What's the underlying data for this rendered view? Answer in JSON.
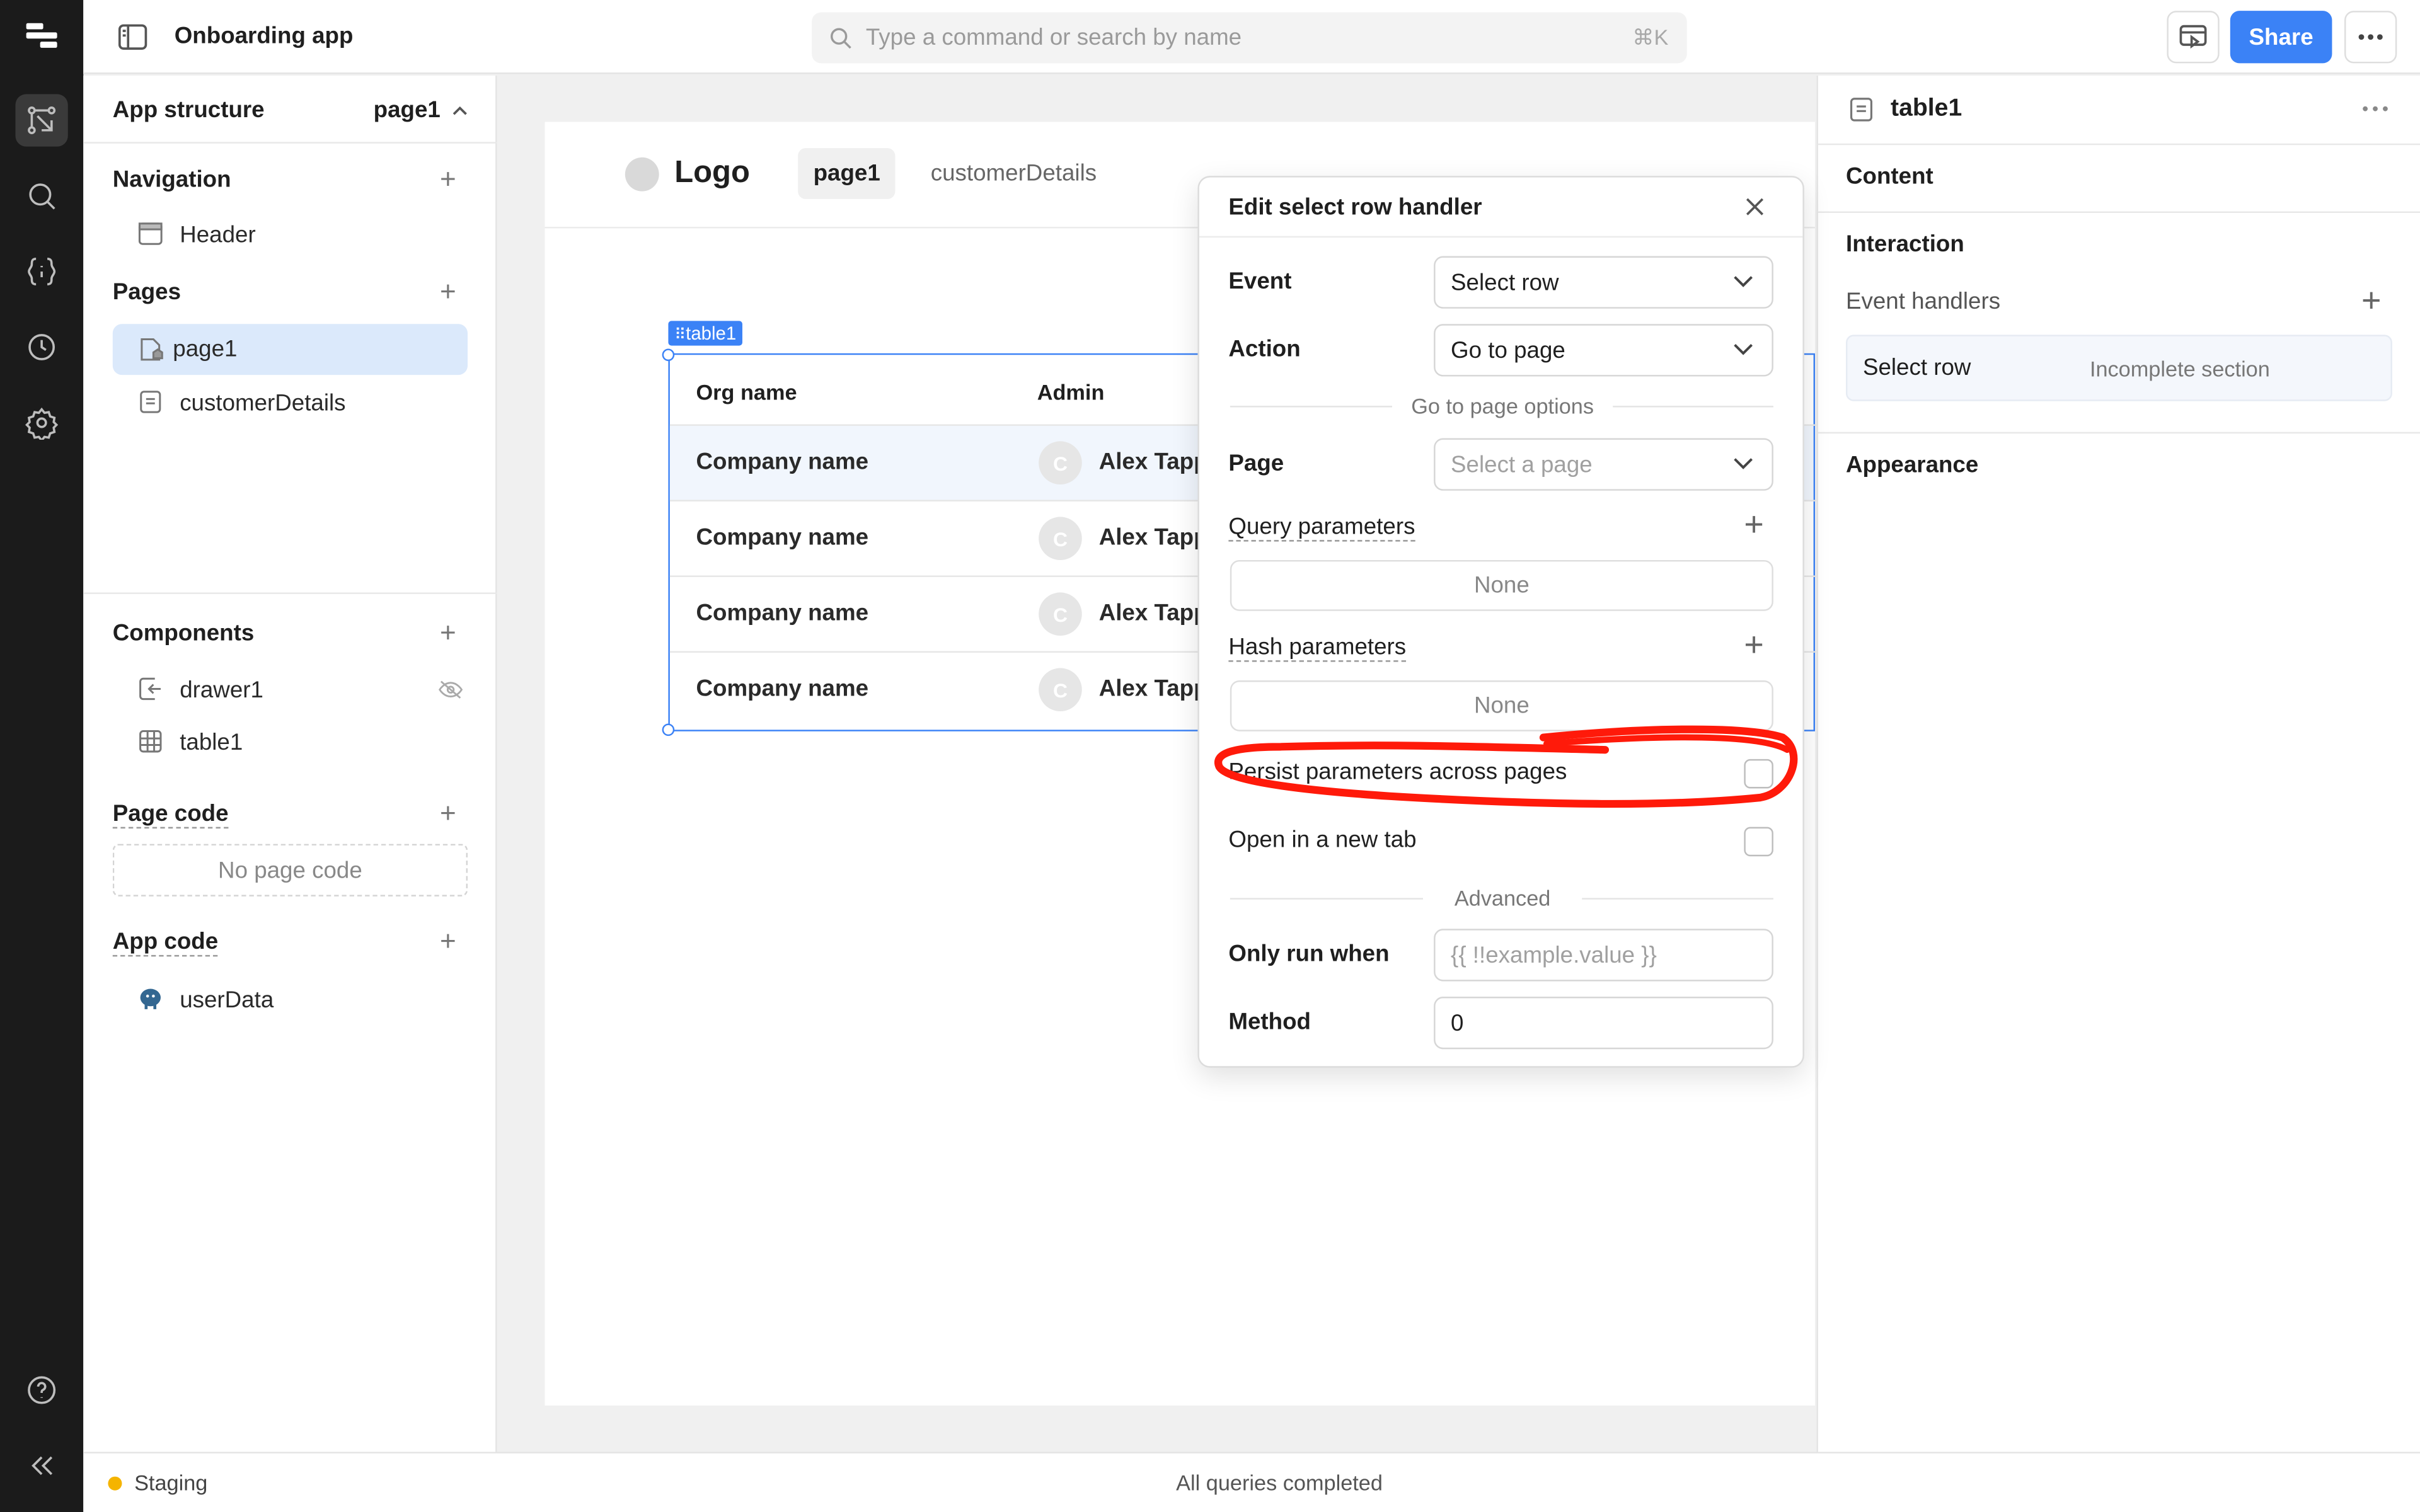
{
  "topbar": {
    "app_title": "Onboarding app",
    "search_placeholder": "Type a command or search by name",
    "search_shortcut": "⌘K",
    "share_label": "Share"
  },
  "sidebar": {
    "header_title": "App structure",
    "header_page": "page1",
    "navigation_title": "Navigation",
    "navigation_items": [
      "Header"
    ],
    "pages_title": "Pages",
    "pages": [
      "page1",
      "customerDetails"
    ],
    "components_title": "Components",
    "components": [
      "drawer1",
      "table1"
    ],
    "page_code_title": "Page code",
    "page_code_empty": "No page code",
    "app_code_title": "App code",
    "app_code_items": [
      "userData"
    ]
  },
  "canvas": {
    "logo_text": "Logo",
    "nav_tabs": [
      "page1",
      "customerDetails"
    ],
    "table_tag": "table1",
    "table": {
      "columns": [
        "Org name",
        "Admin"
      ],
      "rows": [
        {
          "org": "Company name",
          "avatar": "C",
          "admin": "Alex Tapp"
        },
        {
          "org": "Company name",
          "avatar": "C",
          "admin": "Alex Tapp"
        },
        {
          "org": "Company name",
          "avatar": "C",
          "admin": "Alex Tapp"
        },
        {
          "org": "Company name",
          "avatar": "C",
          "admin": "Alex Tapp"
        }
      ]
    }
  },
  "modal": {
    "title": "Edit select row handler",
    "event_label": "Event",
    "event_value": "Select row",
    "action_label": "Action",
    "action_value": "Go to page",
    "options_divider": "Go to page options",
    "page_label": "Page",
    "page_placeholder": "Select a page",
    "query_params_label": "Query parameters",
    "query_params_value": "None",
    "hash_params_label": "Hash parameters",
    "hash_params_value": "None",
    "persist_label": "Persist parameters across pages",
    "persist_checked": false,
    "new_tab_label": "Open in a new tab",
    "new_tab_checked": false,
    "advanced_divider": "Advanced",
    "only_run_label": "Only run when",
    "only_run_placeholder": "{{ !!example.value }}",
    "method_label": "Method",
    "method_value": "0",
    "annotation_color": "#ff1a0a"
  },
  "inspector": {
    "component_name": "table1",
    "content_title": "Content",
    "interaction_title": "Interaction",
    "event_handlers_title": "Event handlers",
    "handler_event": "Select row",
    "handler_status": "Incomplete section",
    "appearance_title": "Appearance"
  },
  "status": {
    "environment": "Staging",
    "environment_color": "#f5b400",
    "queries": "All queries completed"
  },
  "colors": {
    "accent": "#3b82f6",
    "rail_bg": "#1b1b1b"
  }
}
